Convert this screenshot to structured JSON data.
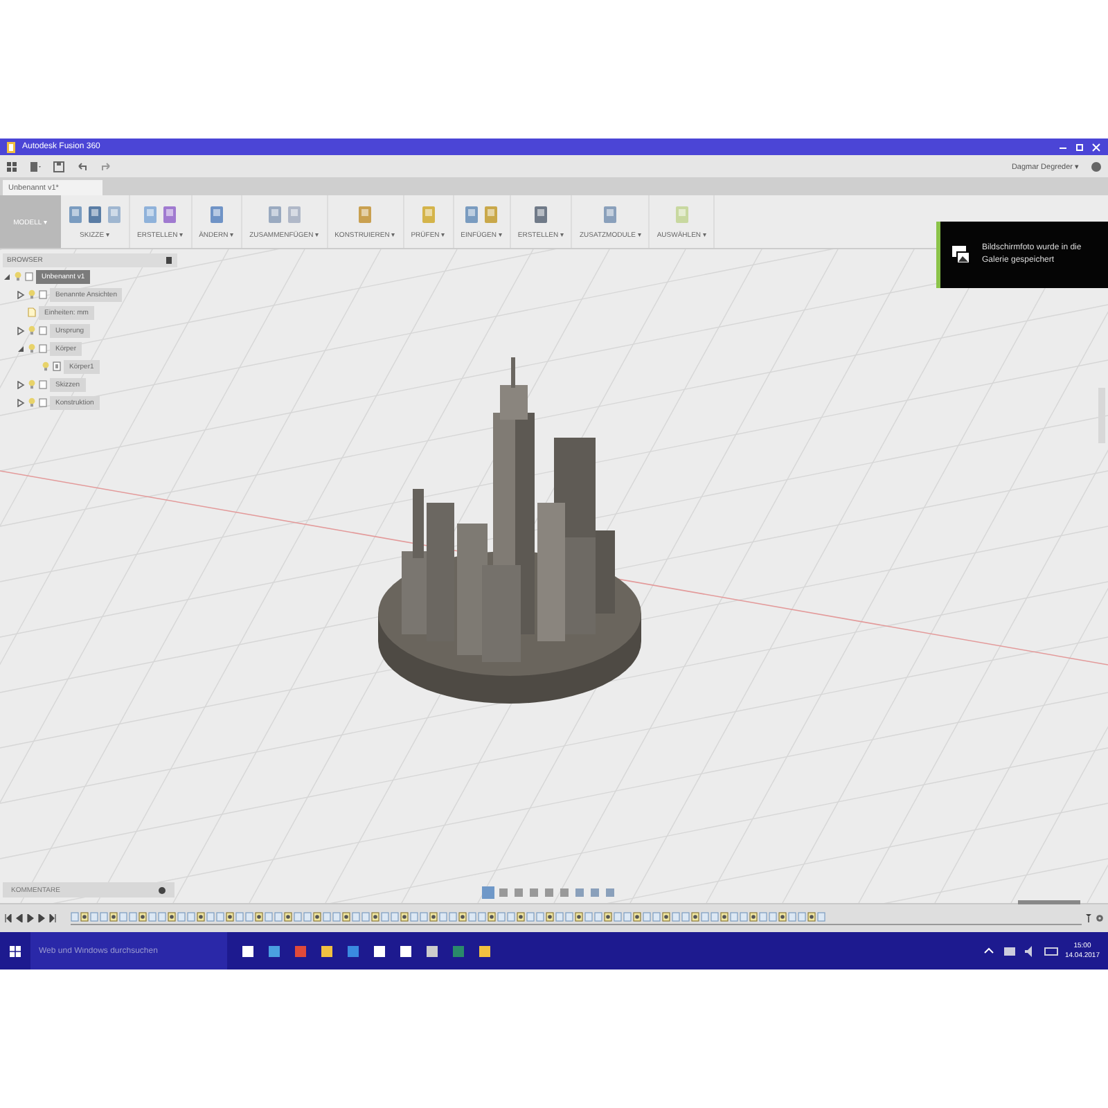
{
  "window": {
    "title": "Autodesk Fusion 360"
  },
  "toolbar": {
    "user": "Dagmar Degreder ▾"
  },
  "document_tab": {
    "label": "Unbenannt v1*",
    "selected": true
  },
  "ribbon": {
    "workspace": "MODELL ▾",
    "groups": [
      {
        "label": "SKIZZE ▾"
      },
      {
        "label": "ERSTELLEN ▾"
      },
      {
        "label": "ÄNDERN ▾"
      },
      {
        "label": "ZUSAMMENFÜGEN ▾"
      },
      {
        "label": "KONSTRUIEREN ▾"
      },
      {
        "label": "PRÜFEN ▾"
      },
      {
        "label": "EINFÜGEN ▾"
      },
      {
        "label": "ERSTELLEN ▾"
      },
      {
        "label": "ZUSATZMODULE ▾"
      },
      {
        "label": "AUSWÄHLEN ▾"
      }
    ]
  },
  "browser": {
    "title": "BROWSER",
    "tree": [
      {
        "label": "Unbenannt v1",
        "kind": "document",
        "expanded": true,
        "selected": true,
        "children": [
          {
            "label": "Benannte Ansichten",
            "kind": "folder",
            "expanded": false,
            "selected": false
          },
          {
            "label": "Einheiten: mm",
            "kind": "units",
            "selected": false
          },
          {
            "label": "Ursprung",
            "kind": "folder",
            "expanded": false,
            "selected": false
          },
          {
            "label": "Körper",
            "kind": "folder",
            "expanded": true,
            "selected": false,
            "children": [
              {
                "label": "Körper1",
                "kind": "body",
                "selected": false
              }
            ]
          },
          {
            "label": "Skizzen",
            "kind": "folder",
            "expanded": false,
            "selected": false
          },
          {
            "label": "Konstruktion",
            "kind": "folder",
            "expanded": false,
            "selected": false
          }
        ]
      }
    ]
  },
  "notification": {
    "text": "Bildschirmfoto wurde in die Galerie gespeichert"
  },
  "comments": {
    "title": "KOMMENTARE"
  },
  "taskbar": {
    "search_placeholder": "Web und Windows durchsuchen",
    "time": "15:00",
    "date": "14.04.2017"
  }
}
